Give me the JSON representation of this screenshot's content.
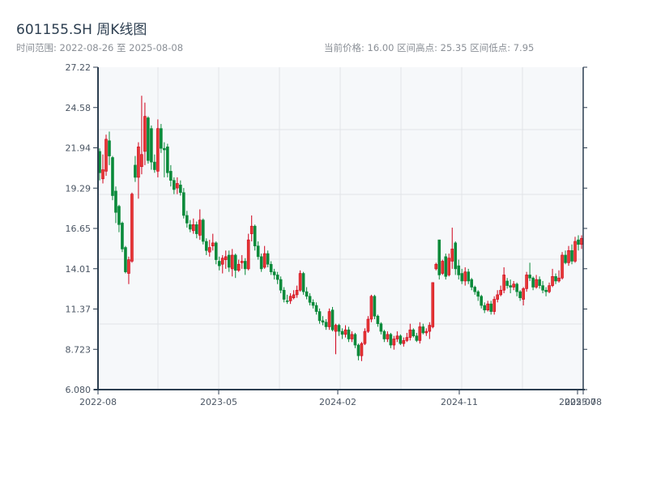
{
  "header": {
    "title": "601155.SH 周K线图",
    "range_label": "时间范围: 2022-08-26 至 2025-08-08",
    "stats_label": "当前价格: 16.00  区间高点: 25.35  区间低点: 7.95"
  },
  "colors": {
    "up": "#d0021b",
    "up_fill": "#e53935",
    "down": "#0a8a3a",
    "plot_bg": "#f6f8fa",
    "grid": "#e1e4e8",
    "axis": "#2c3e50"
  },
  "chart_data": {
    "type": "candlestick",
    "title": "601155.SH 周K线图",
    "period": "weekly",
    "date_range": [
      "2022-08-26",
      "2025-08-08"
    ],
    "ohlc_order": [
      "open",
      "close",
      "low",
      "high"
    ],
    "ylim": [
      6.08,
      27.22
    ],
    "yticks": [
      "6.080",
      "8.723",
      "11.37",
      "14.01",
      "16.65",
      "19.29",
      "21.94",
      "24.58",
      "27.22"
    ],
    "xticks": [
      "2022-08",
      "2023-05",
      "2024-02",
      "2024-11",
      "2025-07",
      "2025-08"
    ],
    "grid": true,
    "ohlc": [
      [
        21.7,
        20.3,
        19.8,
        21.9
      ],
      [
        19.9,
        20.5,
        19.6,
        21.5
      ],
      [
        20.4,
        22.5,
        20.1,
        22.8
      ],
      [
        22.4,
        21.4,
        20.8,
        23.0
      ],
      [
        21.3,
        18.8,
        18.5,
        21.4
      ],
      [
        19.1,
        17.7,
        17.0,
        19.4
      ],
      [
        18.1,
        16.9,
        16.4,
        18.2
      ],
      [
        17.0,
        15.3,
        15.1,
        17.1
      ],
      [
        15.4,
        13.8,
        13.7,
        15.5
      ],
      [
        13.7,
        14.6,
        13.0,
        14.8
      ],
      [
        14.5,
        18.9,
        14.4,
        19.0
      ],
      [
        20.8,
        20.0,
        19.7,
        21.4
      ],
      [
        20.0,
        22.0,
        18.6,
        22.3
      ],
      [
        20.7,
        21.5,
        20.2,
        25.35
      ],
      [
        21.7,
        24.0,
        20.8,
        24.9
      ],
      [
        23.9,
        21.1,
        20.9,
        24.0
      ],
      [
        23.2,
        21.0,
        20.5,
        23.4
      ],
      [
        21.0,
        20.5,
        20.3,
        21.5
      ],
      [
        20.4,
        23.2,
        20.0,
        23.8
      ],
      [
        23.2,
        21.9,
        21.6,
        23.5
      ],
      [
        21.9,
        21.8,
        20.0,
        22.3
      ],
      [
        22.0,
        20.3,
        20.0,
        22.2
      ],
      [
        20.4,
        19.8,
        19.4,
        20.8
      ],
      [
        19.8,
        19.2,
        18.9,
        20.0
      ],
      [
        19.3,
        19.6,
        18.9,
        20.0
      ],
      [
        19.5,
        19.0,
        18.8,
        19.8
      ],
      [
        19.0,
        17.5,
        17.3,
        19.3
      ],
      [
        17.5,
        17.0,
        16.7,
        17.8
      ],
      [
        16.9,
        16.6,
        16.4,
        17.2
      ],
      [
        16.5,
        16.9,
        16.3,
        17.3
      ],
      [
        16.9,
        16.3,
        16.0,
        17.1
      ],
      [
        16.2,
        17.2,
        15.9,
        17.9
      ],
      [
        17.2,
        15.8,
        15.6,
        17.3
      ],
      [
        15.8,
        15.2,
        14.9,
        16.0
      ],
      [
        15.1,
        15.4,
        14.8,
        15.9
      ],
      [
        15.5,
        15.7,
        15.2,
        16.3
      ],
      [
        15.7,
        14.6,
        14.3,
        15.8
      ],
      [
        14.5,
        14.2,
        13.9,
        14.8
      ],
      [
        14.3,
        14.7,
        13.7,
        14.9
      ],
      [
        14.6,
        14.8,
        14.0,
        15.2
      ],
      [
        14.9,
        14.1,
        13.8,
        15.2
      ],
      [
        14.0,
        14.9,
        13.5,
        15.3
      ],
      [
        14.9,
        13.9,
        13.4,
        15.0
      ],
      [
        13.9,
        14.3,
        13.8,
        14.6
      ],
      [
        14.4,
        14.5,
        14.0,
        14.9
      ],
      [
        14.5,
        14.0,
        13.6,
        14.7
      ],
      [
        14.0,
        15.9,
        13.9,
        16.3
      ],
      [
        16.3,
        16.8,
        15.8,
        17.5
      ],
      [
        16.8,
        15.5,
        15.2,
        16.9
      ],
      [
        15.5,
        14.8,
        14.6,
        15.8
      ],
      [
        14.8,
        14.0,
        13.8,
        15.0
      ],
      [
        14.1,
        15.0,
        14.0,
        15.5
      ],
      [
        15.0,
        14.3,
        14.1,
        15.2
      ],
      [
        14.3,
        13.8,
        13.6,
        14.5
      ],
      [
        13.8,
        13.6,
        13.3,
        14.0
      ],
      [
        13.6,
        13.3,
        13.0,
        13.8
      ],
      [
        13.3,
        12.6,
        12.4,
        13.5
      ],
      [
        12.6,
        12.0,
        11.8,
        12.8
      ],
      [
        11.9,
        11.85,
        11.7,
        12.3
      ],
      [
        11.9,
        12.2,
        11.7,
        12.4
      ],
      [
        12.1,
        12.3,
        12.0,
        12.6
      ],
      [
        12.3,
        12.6,
        12.1,
        12.9
      ],
      [
        12.6,
        13.7,
        12.5,
        13.9
      ],
      [
        13.7,
        12.5,
        12.3,
        13.8
      ],
      [
        12.5,
        12.2,
        12.0,
        12.8
      ],
      [
        12.2,
        11.8,
        11.6,
        12.4
      ],
      [
        11.8,
        11.6,
        11.4,
        12.0
      ],
      [
        11.6,
        11.2,
        11.0,
        11.8
      ],
      [
        11.2,
        10.6,
        10.4,
        11.4
      ],
      [
        10.6,
        10.5,
        10.3,
        10.9
      ],
      [
        10.5,
        10.2,
        10.0,
        10.7
      ],
      [
        10.2,
        11.2,
        10.0,
        11.4
      ],
      [
        11.3,
        10.0,
        9.9,
        11.5
      ],
      [
        9.9,
        10.3,
        8.4,
        10.4
      ],
      [
        10.3,
        9.9,
        9.6,
        10.4
      ],
      [
        9.9,
        9.7,
        9.4,
        10.1
      ],
      [
        9.7,
        10.0,
        9.5,
        10.3
      ],
      [
        10.0,
        9.4,
        9.2,
        10.2
      ],
      [
        9.4,
        9.7,
        9.2,
        9.9
      ],
      [
        9.7,
        9.0,
        8.8,
        9.8
      ],
      [
        9.0,
        8.3,
        8.0,
        9.1
      ],
      [
        8.3,
        9.1,
        7.95,
        9.2
      ],
      [
        9.1,
        9.9,
        9.0,
        10.1
      ],
      [
        9.9,
        10.7,
        9.8,
        10.9
      ],
      [
        10.7,
        12.2,
        10.5,
        12.3
      ],
      [
        12.2,
        10.9,
        10.7,
        12.3
      ],
      [
        10.9,
        10.4,
        10.2,
        11.0
      ],
      [
        10.4,
        9.9,
        9.7,
        10.5
      ],
      [
        9.9,
        9.4,
        9.2,
        10.0
      ],
      [
        9.4,
        9.7,
        9.2,
        9.9
      ],
      [
        9.7,
        9.0,
        8.8,
        9.8
      ],
      [
        9.0,
        9.4,
        8.7,
        9.6
      ],
      [
        9.4,
        9.6,
        9.2,
        9.9
      ],
      [
        9.6,
        9.1,
        9.0,
        9.7
      ],
      [
        9.1,
        9.3,
        8.9,
        9.5
      ],
      [
        9.3,
        9.5,
        9.2,
        9.8
      ],
      [
        9.5,
        10.0,
        9.3,
        10.4
      ],
      [
        10.0,
        9.6,
        9.5,
        10.1
      ],
      [
        9.6,
        9.3,
        9.2,
        9.8
      ],
      [
        9.3,
        10.2,
        9.1,
        10.5
      ],
      [
        10.2,
        9.8,
        9.7,
        10.4
      ],
      [
        9.8,
        9.9,
        9.6,
        10.1
      ],
      [
        9.9,
        10.3,
        9.4,
        10.5
      ],
      [
        10.2,
        13.1,
        10.1,
        13.1
      ],
      [
        14.0,
        14.3,
        13.9,
        14.4
      ],
      [
        15.9,
        13.6,
        13.3,
        15.9
      ],
      [
        13.7,
        14.5,
        13.6,
        14.6
      ],
      [
        14.8,
        13.5,
        13.3,
        15.0
      ],
      [
        13.6,
        14.7,
        13.5,
        15.0
      ],
      [
        14.5,
        15.3,
        14.0,
        16.7
      ],
      [
        15.7,
        14.0,
        13.6,
        15.8
      ],
      [
        14.2,
        13.6,
        13.3,
        14.6
      ],
      [
        13.7,
        13.2,
        13.0,
        14.0
      ],
      [
        13.2,
        13.8,
        12.9,
        14.1
      ],
      [
        13.8,
        13.2,
        13.0,
        14.0
      ],
      [
        13.3,
        12.8,
        12.6,
        13.4
      ],
      [
        12.8,
        12.5,
        12.3,
        12.9
      ],
      [
        12.5,
        12.2,
        11.9,
        12.6
      ],
      [
        12.2,
        11.6,
        11.4,
        12.3
      ],
      [
        11.6,
        11.3,
        11.1,
        11.8
      ],
      [
        11.3,
        11.7,
        11.2,
        11.9
      ],
      [
        11.7,
        11.2,
        11.0,
        11.9
      ],
      [
        11.2,
        12.0,
        11.0,
        12.2
      ],
      [
        12.0,
        12.3,
        11.8,
        12.6
      ],
      [
        12.3,
        12.6,
        12.2,
        12.9
      ],
      [
        12.6,
        13.6,
        12.4,
        14.1
      ],
      [
        13.2,
        12.9,
        12.7,
        13.4
      ],
      [
        12.9,
        12.8,
        12.4,
        13.3
      ],
      [
        12.8,
        13.0,
        12.6,
        13.2
      ],
      [
        13.0,
        12.5,
        12.2,
        13.1
      ],
      [
        12.5,
        12.1,
        11.9,
        12.6
      ],
      [
        12.0,
        12.7,
        11.6,
        12.8
      ],
      [
        12.7,
        13.6,
        12.5,
        13.8
      ],
      [
        13.6,
        13.4,
        13.2,
        14.4
      ],
      [
        13.4,
        12.8,
        12.6,
        13.5
      ],
      [
        12.8,
        13.3,
        12.7,
        13.6
      ],
      [
        13.3,
        12.9,
        12.7,
        13.5
      ],
      [
        12.9,
        12.6,
        12.4,
        13.2
      ],
      [
        12.6,
        12.5,
        12.2,
        12.8
      ],
      [
        12.5,
        12.9,
        12.4,
        13.1
      ],
      [
        12.9,
        13.5,
        12.8,
        14.0
      ],
      [
        13.5,
        13.2,
        13.0,
        13.7
      ],
      [
        13.2,
        13.4,
        13.1,
        13.9
      ],
      [
        13.4,
        14.9,
        13.3,
        15.1
      ],
      [
        14.9,
        14.4,
        14.3,
        15.2
      ],
      [
        14.4,
        15.2,
        14.2,
        15.5
      ],
      [
        15.2,
        14.5,
        14.3,
        15.6
      ],
      [
        14.5,
        15.8,
        14.4,
        16.1
      ],
      [
        15.9,
        15.6,
        15.2,
        16.2
      ],
      [
        15.6,
        16.0,
        15.3,
        16.2
      ]
    ]
  }
}
